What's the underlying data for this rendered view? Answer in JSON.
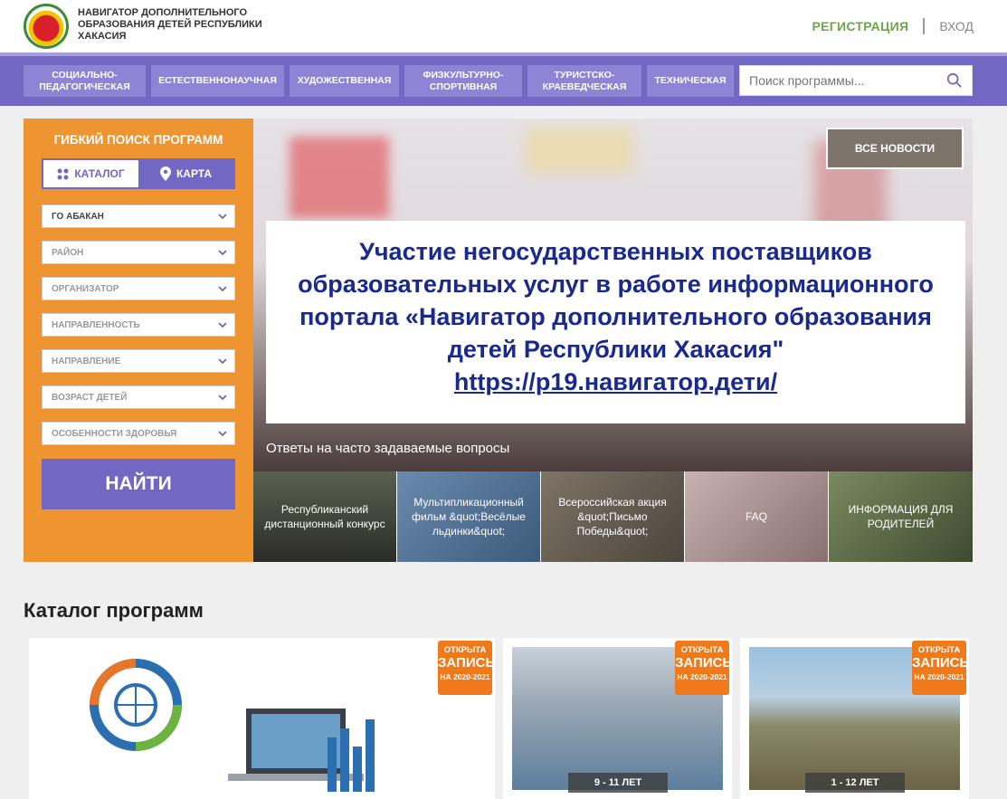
{
  "header": {
    "title": "НАВИГАТОР ДОПОЛНИТЕЛЬНОГО ОБРАЗОВАНИЯ ДЕТЕЙ РЕСПУБЛИКИ ХАКАСИЯ",
    "register": "РЕГИСТРАЦИЯ",
    "login": "ВХОД"
  },
  "nav": {
    "items": [
      "СОЦИАЛЬНО-ПЕДАГОГИЧЕСКАЯ",
      "ЕСТЕСТВЕННОНАУЧНАЯ",
      "ХУДОЖЕСТВЕННАЯ",
      "ФИЗКУЛЬТУРНО-СПОРТИВНАЯ",
      "ТУРИСТСКО-КРАЕВЕДЧЕСКАЯ",
      "ТЕХНИЧЕСКАЯ"
    ],
    "search_placeholder": "Поиск программы..."
  },
  "filters": {
    "title": "ГИБКИЙ ПОИСК ПРОГРАММ",
    "catalog": "КАТАЛОГ",
    "map": "КАРТА",
    "selects": [
      "ГО АБАКАН",
      "РАЙОН",
      "ОРГАНИЗАТОР",
      "НАПРАВЛЕННОСТЬ",
      "НАПРАВЛЕНИЕ",
      "ВОЗРАСТ ДЕТЕЙ",
      "ОСОБЕННОСТИ ЗДОРОВЬЯ"
    ],
    "find": "НАЙТИ"
  },
  "hero": {
    "all_news": "ВСЕ НОВОСТИ",
    "banner_lines": [
      "Участие негосударственных поставщиков",
      "образовательных услуг в работе информационного",
      "портала «Навигатор дополнительного образования",
      "детей Республики Хакасия\""
    ],
    "banner_link": "https://p19.навигатор.дети/",
    "caption": "Ответы на часто задаваемые вопросы"
  },
  "tiles": [
    "Республиканский дистанционный конкурс",
    "Мультипликационный фильм &quot;Весёлые льдинки&quot;",
    "Всероссийская акция &quot;Письмо Победы&quot;",
    "FAQ",
    "ИНФОРМАЦИЯ ДЛЯ РОДИТЕЛЕЙ"
  ],
  "catalog": {
    "title": "Каталог программ",
    "badge": {
      "line1": "ОТКРЫТА",
      "line2": "ЗАПИСЬ",
      "line3": "НА 2020-2021"
    },
    "cards": [
      {
        "age": ""
      },
      {
        "age": "9 - 11 ЛЕТ"
      },
      {
        "age": "1 - 12 ЛЕТ"
      }
    ]
  },
  "colors": {
    "nav": "#7367c4",
    "sidebar": "#ee9431",
    "accent_green": "#6aa845",
    "badge": "#f07a1a",
    "banner_text": "#1a2a8c"
  }
}
